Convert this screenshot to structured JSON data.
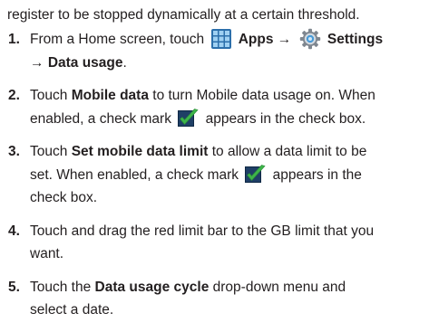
{
  "top_fragment": "register to be stopped dynamically at a certain threshold.",
  "steps": [
    {
      "number": "1.",
      "line1": {
        "before_apps": "From a Home screen, touch",
        "apps_label": "Apps",
        "arrow": "→",
        "settings_label": "Settings"
      },
      "line2": {
        "arrow": "→",
        "data_usage_label": "Data usage",
        "end": "."
      }
    },
    {
      "number": "2.",
      "line1": {
        "before": "Touch",
        "bold": "Mobile data",
        "after": "to turn Mobile data usage on. When"
      },
      "line2": {
        "before_check": "enabled, a check mark",
        "after_check": "appears in the check box."
      }
    },
    {
      "number": "3.",
      "line1": {
        "before": "Touch",
        "bold": "Set mobile data limit",
        "after": "to allow a data limit to be"
      },
      "line2": {
        "before_check": "set. When enabled, a check mark",
        "after_check": "appears in the"
      },
      "line3": "check box."
    },
    {
      "number": "4.",
      "line1": "Touch and drag the red limit bar to the GB limit that you",
      "line2": "want."
    },
    {
      "number": "5.",
      "line1": {
        "before": "Touch the",
        "bold": "Data usage cycle",
        "after": "drop-down menu and"
      },
      "line2": "select a date."
    }
  ],
  "icons": {
    "apps": "apps-grid-icon",
    "settings": "settings-gear-icon",
    "check": "green-check-mark-icon"
  },
  "colors": {
    "text": "#231f20",
    "apps_icon_blue": "#3a8fd0",
    "check_green": "#3db54a",
    "check_box_navy": "#1f3f66",
    "gear_gray": "#7f8790",
    "gear_blue_center": "#4a9bd8"
  }
}
